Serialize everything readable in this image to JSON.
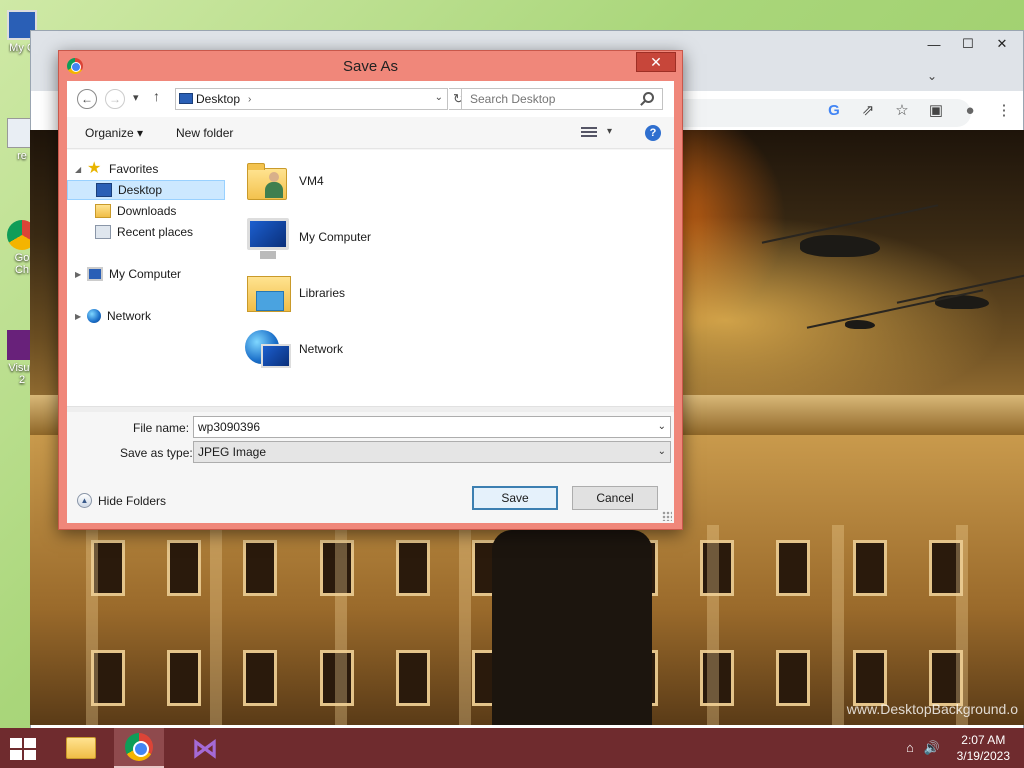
{
  "desktop": {
    "icons": [
      {
        "label": "My C",
        "name": "my-computer"
      },
      {
        "label": "re",
        "name": "recycle-bin"
      },
      {
        "label": "Go\nCh",
        "name": "google-chrome"
      },
      {
        "label": "Visua\n2",
        "name": "visual-studio"
      }
    ]
  },
  "wallpaper": {
    "watermark": "www.DesktopBackground.o"
  },
  "dialog": {
    "title": "Save As",
    "close_label": "✕",
    "address": {
      "back_label": "←",
      "forward_label": "→",
      "recent_label": "▾",
      "up_label": "↑",
      "current": "Desktop",
      "separator": "›",
      "dropdown_label": "⌄",
      "refresh_label": "↻",
      "search_placeholder": "Search Desktop"
    },
    "commands": {
      "organize": "Organize ▾",
      "new_folder": "New folder",
      "view_dropdown": "▾",
      "help": "?"
    },
    "nav": {
      "favorites": "Favorites",
      "desktop": "Desktop",
      "downloads": "Downloads",
      "recent_places": "Recent places",
      "my_computer": "My Computer",
      "network": "Network",
      "expand_arrow": "▶",
      "collapse_arrow": "◢"
    },
    "items": [
      {
        "label": "VM4"
      },
      {
        "label": "My Computer"
      },
      {
        "label": "Libraries"
      },
      {
        "label": "Network"
      }
    ],
    "form": {
      "file_name_label": "File name:",
      "file_name_value": "wp3090396",
      "save_type_label": "Save as type:",
      "save_type_value": "JPEG Image",
      "dropdown_label": "⌄"
    },
    "hide_folders": "Hide Folders",
    "hide_folders_icon": "▲",
    "save": "Save",
    "cancel": "Cancel"
  },
  "chrome": {
    "ctrl_min": "—",
    "ctrl_max": "☐",
    "ctrl_close": "✕",
    "tab_dropdown": "⌄",
    "toolbar_icons": [
      "G",
      "⇗",
      "☆",
      "▣",
      "●",
      "⋮"
    ]
  },
  "taskbar": {
    "time": "2:07 AM",
    "date": "3/19/2023",
    "vs_glyph": "⋈",
    "tray_network": "⌂",
    "tray_volume": "🔊"
  }
}
